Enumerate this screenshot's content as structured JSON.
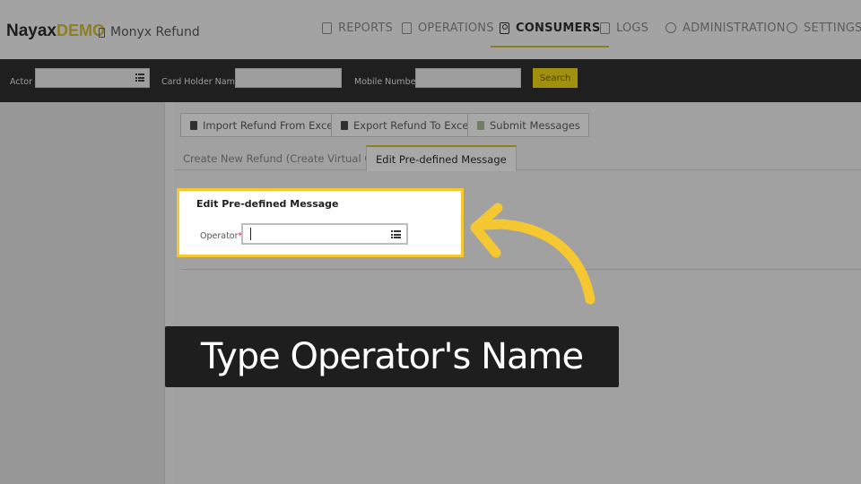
{
  "app": {
    "brand_main": "Nayax",
    "brand_demo": "DEMO",
    "subtitle": "Monyx Refund"
  },
  "nav": {
    "items": [
      {
        "label": "REPORTS",
        "icon": "report-icon",
        "active": false
      },
      {
        "label": "OPERATIONS",
        "icon": "phone-icon",
        "active": false
      },
      {
        "label": "CONSUMERS",
        "icon": "user-icon",
        "active": true
      },
      {
        "label": "LOGS",
        "icon": "log-icon",
        "active": false
      },
      {
        "label": "ADMINISTRATION",
        "icon": "compass-icon",
        "active": false
      },
      {
        "label": "SETTINGS",
        "icon": "gear-icon",
        "active": false
      }
    ]
  },
  "search": {
    "actor_label": "Actor",
    "card_holder_label": "Card Holder Name",
    "mobile_label": "Mobile Number",
    "button_label": "Search"
  },
  "toolbar": {
    "import_label": "Import Refund From Excel",
    "export_label": "Export Refund To Excel",
    "submit_label": "Submit Messages"
  },
  "tabs": [
    {
      "label": "Create New Refund (Create Virtual Card)",
      "active": false
    },
    {
      "label": "Edit Pre-defined Message",
      "active": true
    }
  ],
  "form": {
    "section_title": "Edit Pre-defined Message",
    "operator_label": "Operator",
    "required_mark": "*",
    "operator_value": ""
  },
  "annotation": {
    "callout_text": "Type Operator's Name",
    "highlight_color": "#f5c832",
    "arrow_color": "#f5c832"
  },
  "colors": {
    "accent": "#8d7d23",
    "search_button": "#a18f0e",
    "dark_bar": "#1f1f1f"
  }
}
